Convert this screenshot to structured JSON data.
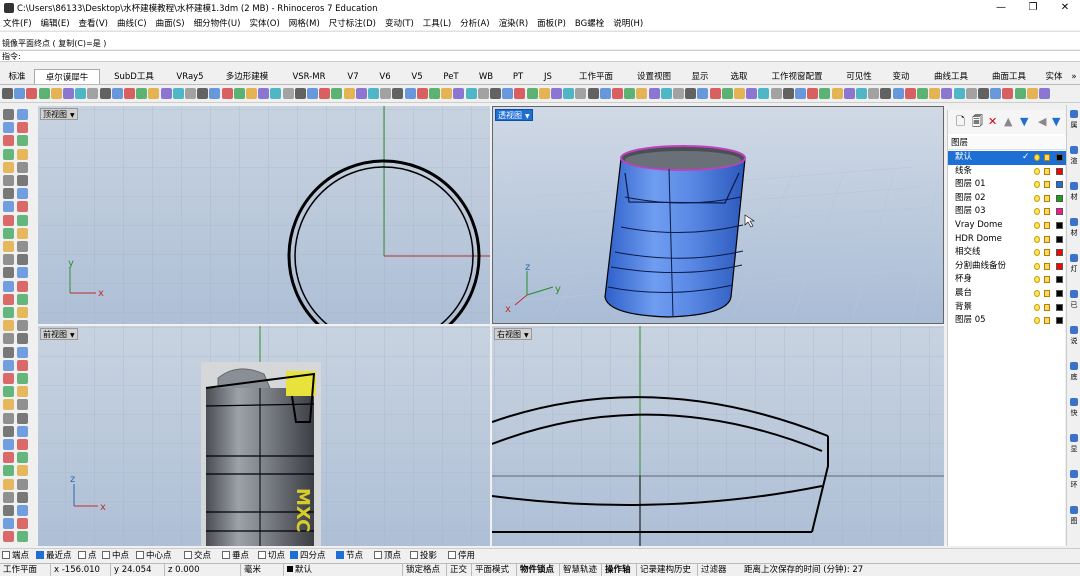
{
  "window": {
    "title": "C:\\Users\\86133\\Desktop\\水杯建模教程\\水杯建模1.3dm (2 MB) - Rhinoceros 7 Education",
    "minimize": "—",
    "maximize": "❐",
    "close": "✕"
  },
  "menu": [
    "文件(F)",
    "编辑(E)",
    "查看(V)",
    "曲线(C)",
    "曲面(S)",
    "细分物件(U)",
    "实体(O)",
    "网格(M)",
    "尺寸标注(D)",
    "变动(T)",
    "工具(L)",
    "分析(A)",
    "渲染(R)",
    "面板(P)",
    "BG螺栓",
    "说明(H)"
  ],
  "command": {
    "history": "镜像平面终点 ( 复制(C)=是 )",
    "prompt": "指令:"
  },
  "tabs": [
    "标准",
    "卓尔谟犀牛",
    "SubD工具",
    "VRay5",
    "多边形建模",
    "VSR-MR",
    "V7",
    "V6",
    "V5",
    "PeT",
    "WB",
    "PT",
    "JS",
    "工作平面",
    "设置视图",
    "显示",
    "选取",
    "工作视窗配置",
    "可见性",
    "变动",
    "曲线工具",
    "曲面工具",
    "实体"
  ],
  "tabs_active": "卓尔谟犀牛",
  "viewports": {
    "top": {
      "label": "顶视图"
    },
    "perspective": {
      "label": "透视图"
    },
    "front": {
      "label": "前视图"
    },
    "right": {
      "label": "右视图"
    }
  },
  "axes": {
    "x": "x",
    "y": "y",
    "z": "z"
  },
  "front_decal": "MXC",
  "layers": {
    "header": "图层",
    "items": [
      {
        "name": "默认",
        "color": "#000000",
        "current": true,
        "check": "✓"
      },
      {
        "name": "线条",
        "color": "#ff0000"
      },
      {
        "name": "图层 01",
        "color": "#1e6fd4"
      },
      {
        "name": "图层 02",
        "color": "#19a019"
      },
      {
        "name": "图层 03",
        "color": "#ff1493"
      },
      {
        "name": "Vray Dome",
        "color": "#000000"
      },
      {
        "name": "HDR Dome",
        "color": "#000000"
      },
      {
        "name": "相交线",
        "color": "#ff0000"
      },
      {
        "name": "分割曲线备份",
        "color": "#ff0000"
      },
      {
        "name": "杯身",
        "color": "#000000"
      },
      {
        "name": "晨台",
        "color": "#000000"
      },
      {
        "name": "背景",
        "color": "#000000"
      },
      {
        "name": "图层 05",
        "color": "#000000"
      }
    ]
  },
  "panel_tools": [
    "🗋",
    "🗐",
    "✕",
    "▲",
    "▼",
    "◀",
    "▼"
  ],
  "right_strip": [
    "属",
    "渲",
    "材",
    "材",
    "灯",
    "已",
    "说",
    "底",
    "快",
    "显",
    "环",
    "图"
  ],
  "osnap": [
    {
      "label": "端点",
      "on": false
    },
    {
      "label": "最近点",
      "on": true
    },
    {
      "label": "点",
      "on": false
    },
    {
      "label": "中点",
      "on": false
    },
    {
      "label": "中心点",
      "on": false
    },
    {
      "label": "交点",
      "on": false
    },
    {
      "label": "垂点",
      "on": false
    },
    {
      "label": "切点",
      "on": false
    },
    {
      "label": "四分点",
      "on": true
    },
    {
      "label": "节点",
      "on": true
    },
    {
      "label": "顶点",
      "on": false
    },
    {
      "label": "投影",
      "on": false
    },
    {
      "label": "停用",
      "on": false
    }
  ],
  "status": {
    "cplane": "工作平面",
    "x": "x -156.010",
    "y": "y 24.054",
    "z": "z 0.000",
    "unit": "毫米",
    "layer": "默认",
    "grid_snap": "锁定格点",
    "ortho": "正交",
    "planar": "平面模式",
    "osnap": "物件锁点",
    "smarttrack": "智慧轨迹",
    "gumball": "操作轴",
    "history": "记录建构历史",
    "filter": "过滤器",
    "autosave": "距离上次保存的时间 (分钟): 27"
  }
}
